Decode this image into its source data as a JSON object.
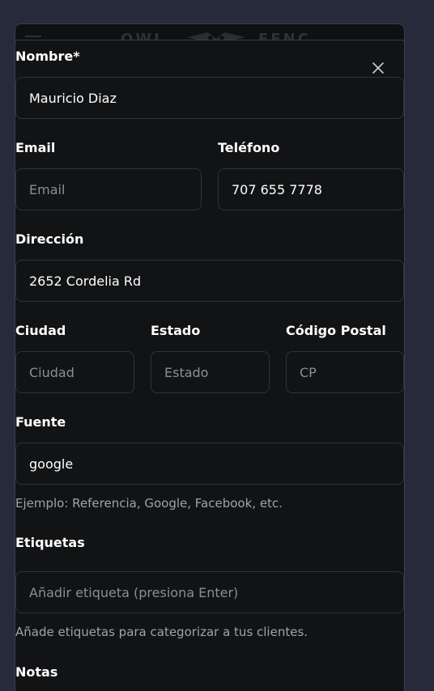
{
  "backdrop": {
    "logo_left": "OWL",
    "logo_right": "FENC"
  },
  "form": {
    "nombre": {
      "label": "Nombre*",
      "value": "Mauricio Diaz"
    },
    "email": {
      "label": "Email",
      "placeholder": "Email"
    },
    "telefono": {
      "label": "Teléfono",
      "value": "707 655 7778"
    },
    "direccion": {
      "label": "Dirección",
      "value": "2652 Cordelia Rd"
    },
    "ciudad": {
      "label": "Ciudad",
      "placeholder": "Ciudad"
    },
    "estado": {
      "label": "Estado",
      "placeholder": "Estado"
    },
    "cp": {
      "label": "Código Postal",
      "placeholder": "CP"
    },
    "fuente": {
      "label": "Fuente",
      "value": "google",
      "hint": "Ejemplo: Referencia, Google, Facebook, etc."
    },
    "etiquetas": {
      "label": "Etiquetas",
      "placeholder": "Añadir etiqueta (presiona Enter)",
      "hint": "Añade etiquetas para categorizar a tus clientes."
    },
    "notas": {
      "label": "Notas"
    }
  },
  "icons": {
    "close": "close-icon",
    "logo": "owl-logo-icon"
  }
}
